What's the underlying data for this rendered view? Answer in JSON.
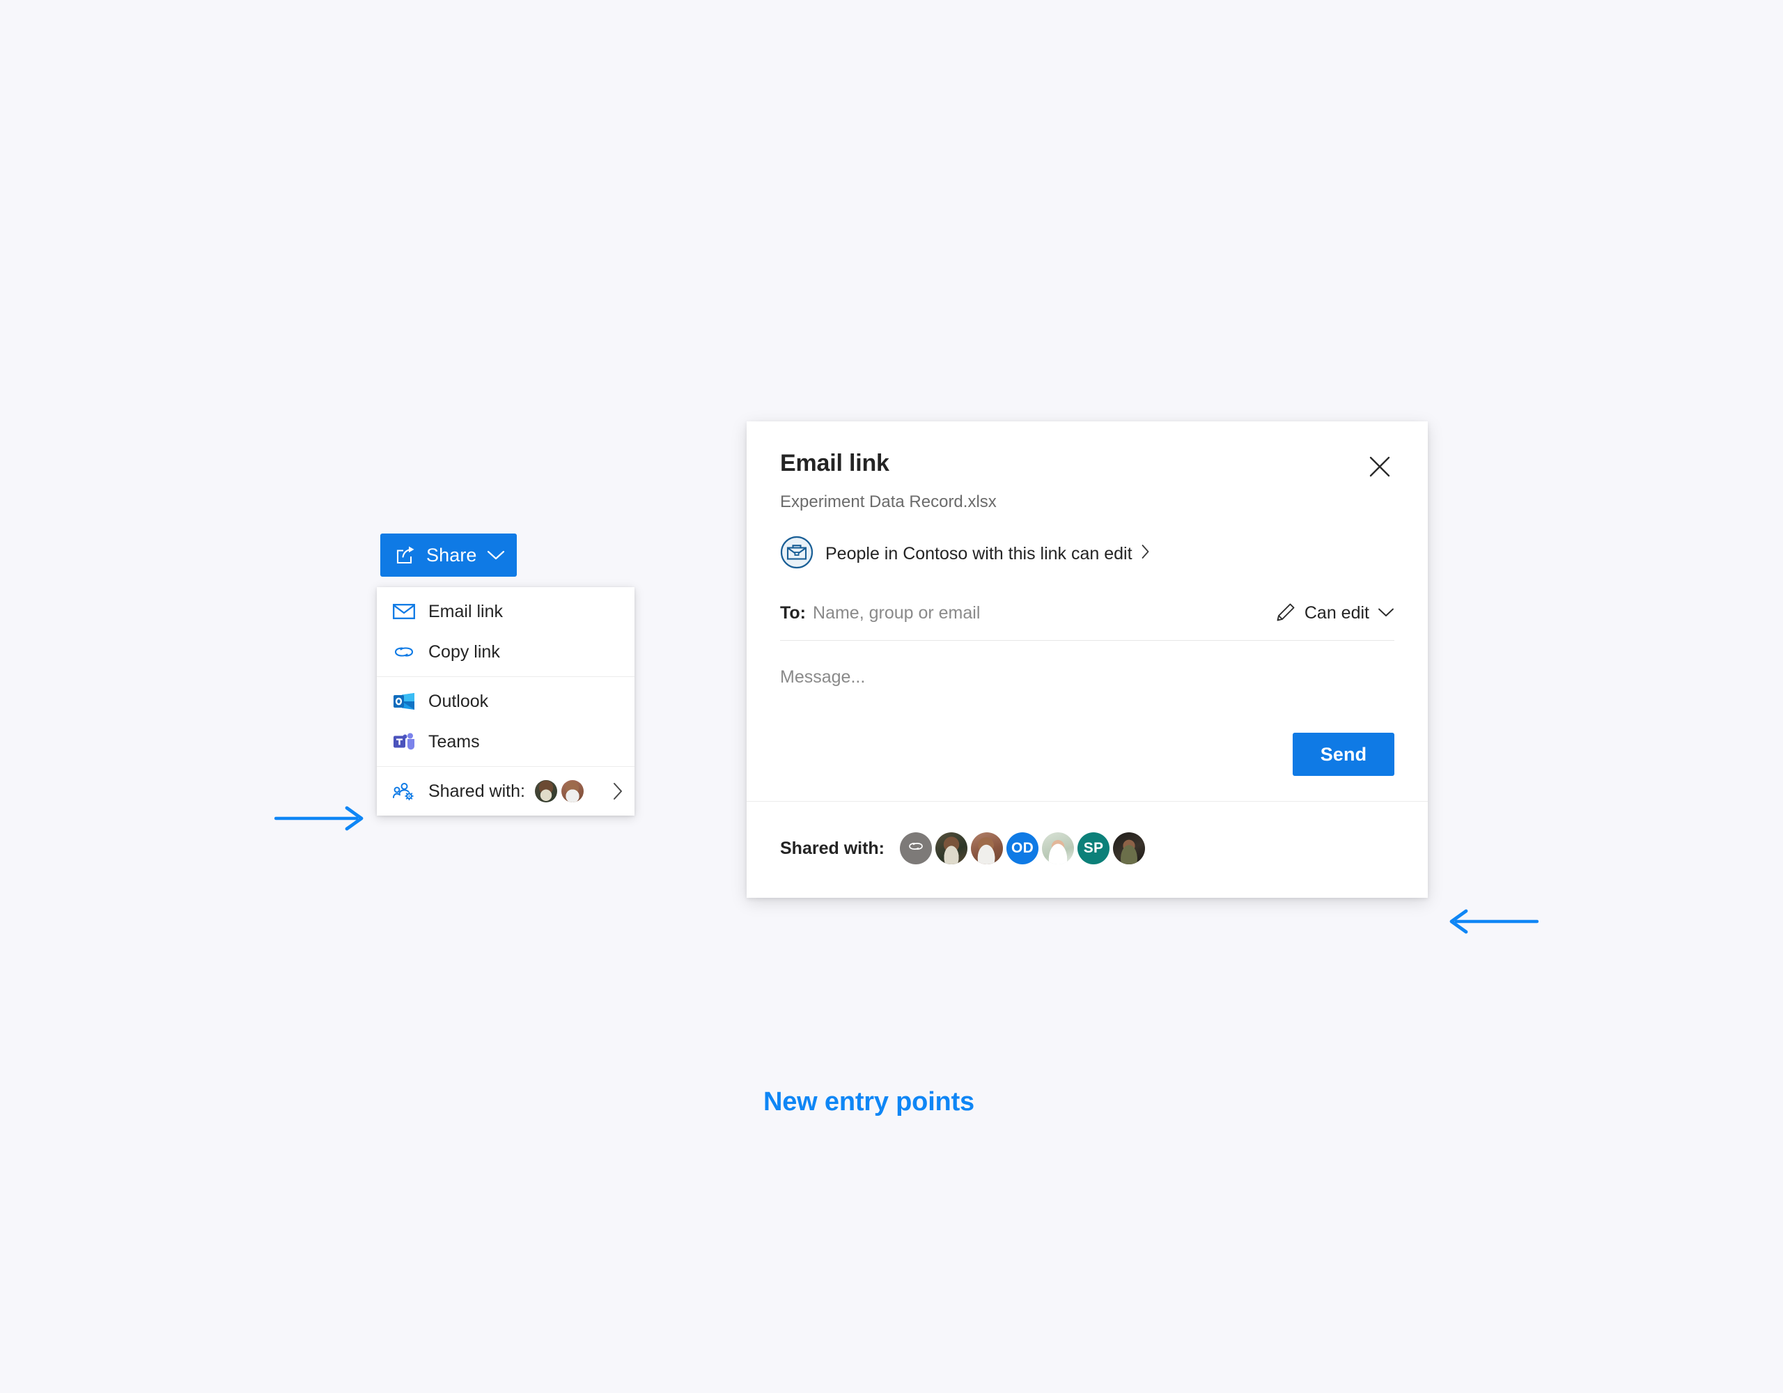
{
  "page": {
    "background_color": "#f7f7fb",
    "accent_color": "#0f7ae5",
    "caption": "New entry points"
  },
  "share_button": {
    "label": "Share",
    "icon": "share-icon",
    "chevron_icon": "chevron-down-icon",
    "background_color": "#0f7ae5"
  },
  "share_menu": {
    "groups": [
      {
        "items": [
          {
            "label": "Email link",
            "icon": "envelope-icon"
          },
          {
            "label": "Copy link",
            "icon": "link-chain-icon"
          }
        ]
      },
      {
        "items": [
          {
            "label": "Outlook",
            "icon": "outlook-icon"
          },
          {
            "label": "Teams",
            "icon": "teams-icon"
          }
        ]
      },
      {
        "items": [
          {
            "label": "Shared with:",
            "icon": "people-settings-icon",
            "chevron_icon": "chevron-right-icon"
          }
        ]
      }
    ],
    "shared_with_faces": [
      {
        "type": "photo",
        "tone": "#8a6a55"
      },
      {
        "type": "photo",
        "tone": "#b08a6e"
      }
    ]
  },
  "dialog": {
    "title": "Email link",
    "subtitle": "Experiment Data Record.xlsx",
    "close_icon": "close-icon",
    "scope": {
      "icon": "briefcase-icon",
      "text": "People in Contoso with this link can edit",
      "chevron_icon": "chevron-right-icon"
    },
    "to_field": {
      "label": "To:",
      "value": "",
      "placeholder": "Name, group or email"
    },
    "permission": {
      "icon": "pencil-icon",
      "label": "Can edit",
      "chevron_icon": "chevron-down-icon"
    },
    "message_field": {
      "value": "",
      "placeholder": "Message..."
    },
    "send_button": {
      "label": "Send",
      "background_color": "#0f7ae5"
    },
    "footer": {
      "label": "Shared with:",
      "faces": [
        {
          "type": "link",
          "initials": "",
          "color": "#7d7a78",
          "icon": "link-chain-icon"
        },
        {
          "type": "photo",
          "initials": "",
          "color": "#3c3229"
        },
        {
          "type": "photo",
          "initials": "",
          "color": "#9c7a60"
        },
        {
          "type": "initials",
          "initials": "OD",
          "color": "#0f7ae5"
        },
        {
          "type": "photo",
          "initials": "",
          "color": "#cfd8cf"
        },
        {
          "type": "initials",
          "initials": "SP",
          "color": "#0c8079"
        },
        {
          "type": "photo",
          "initials": "",
          "color": "#2c2a26"
        }
      ]
    }
  },
  "annotations": {
    "left_arrow": {
      "direction": "right",
      "color": "#0f86f5"
    },
    "right_arrow": {
      "direction": "left",
      "color": "#0f86f5"
    }
  }
}
